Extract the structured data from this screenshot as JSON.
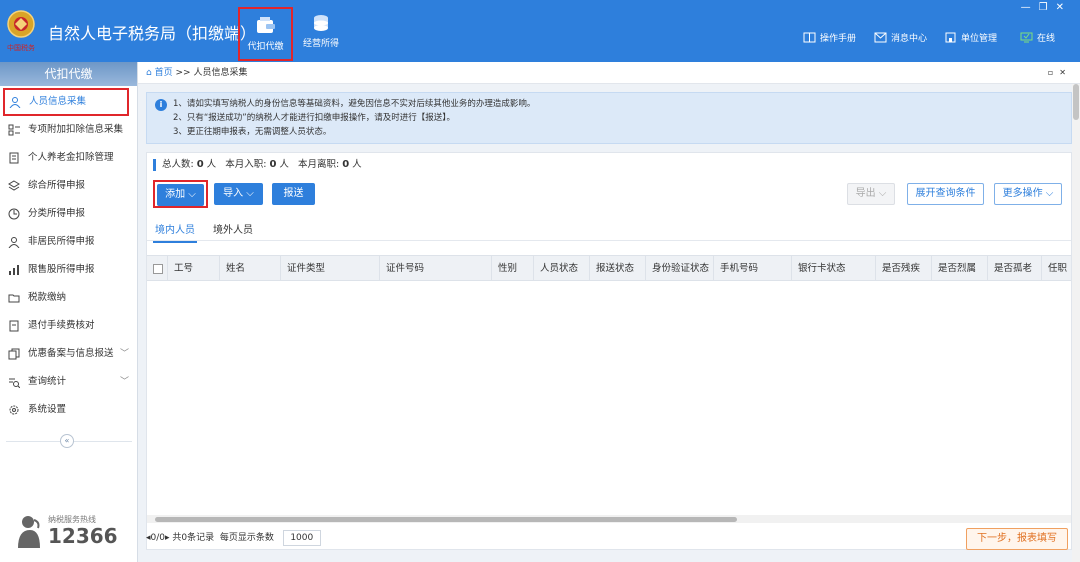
{
  "header": {
    "logo_text": "中国税务",
    "title": "自然人电子税务局（扣缴端）",
    "nav": [
      {
        "label": "代扣代缴",
        "active": true
      },
      {
        "label": "经营所得",
        "active": false
      }
    ],
    "right": [
      {
        "label": "操作手册",
        "icon": "book-icon"
      },
      {
        "label": "消息中心",
        "icon": "mail-icon"
      },
      {
        "label": "单位管理",
        "icon": "building-icon"
      },
      {
        "label": "在线",
        "icon": "monitor-check-icon"
      }
    ],
    "window_controls": [
      "—",
      "❐",
      "✕"
    ]
  },
  "sidebar": {
    "title": "代扣代缴",
    "items": [
      {
        "label": "人员信息采集",
        "icon": "person-icon",
        "active": true
      },
      {
        "label": "专项附加扣除信息采集",
        "icon": "grid-list-icon"
      },
      {
        "label": "个人养老金扣除管理",
        "icon": "document-icon"
      },
      {
        "label": "综合所得申报",
        "icon": "layers-icon"
      },
      {
        "label": "分类所得申报",
        "icon": "pie-clock-icon"
      },
      {
        "label": "非居民所得申报",
        "icon": "person-outline-icon"
      },
      {
        "label": "限售股所得申报",
        "icon": "bar-chart-icon"
      },
      {
        "label": "税款缴纳",
        "icon": "folder-icon"
      },
      {
        "label": "退付手续费核对",
        "icon": "receipt-icon"
      },
      {
        "label": "优惠备案与信息报送",
        "icon": "file-copy-icon",
        "expandable": true
      },
      {
        "label": "查询统计",
        "icon": "search-list-icon",
        "expandable": true
      },
      {
        "label": "系统设置",
        "icon": "gear-icon"
      }
    ],
    "collapse_glyph": "«",
    "hotline_label": "纳税服务热线",
    "hotline_number": "12366"
  },
  "breadcrumb": {
    "home": "首页",
    "sep": ">>",
    "current": "人员信息采集"
  },
  "notice": [
    "1、请如实填写纳税人的身份信息等基础资料，避免因信息不实对后续其他业务的办理造成影响。",
    "2、只有“报送成功”的纳税人才能进行扣缴申报操作，请及时进行【报送】。",
    "3、更正往期申报表，无需调整人员状态。"
  ],
  "stats": {
    "total_label": "总人数:",
    "total_value": "0",
    "total_unit": "人",
    "join_label": "本月入职:",
    "join_value": "0",
    "join_unit": "人",
    "leave_label": "本月离职:",
    "leave_value": "0",
    "leave_unit": "人"
  },
  "toolbar": {
    "add": "添加",
    "import": "导入",
    "submit": "报送",
    "export": "导出",
    "expand_query": "展开查询条件",
    "more": "更多操作"
  },
  "tabs": [
    "境内人员",
    "境外人员"
  ],
  "table": {
    "columns": [
      "工号",
      "姓名",
      "证件类型",
      "证件号码",
      "性别",
      "人员状态",
      "报送状态",
      "身份验证状态",
      "手机号码",
      "银行卡状态",
      "是否残疾",
      "是否烈属",
      "是否孤老",
      "任职"
    ],
    "rows": []
  },
  "pager": {
    "page": "0/0",
    "records": "共0条记录",
    "per_page_label": "每页显示条数",
    "per_page_value": "1000"
  },
  "next_button": "下一步，报表填写",
  "colors": {
    "brand": "#2e7fdc",
    "highlight": "#e0262b",
    "next": "#e07020"
  }
}
